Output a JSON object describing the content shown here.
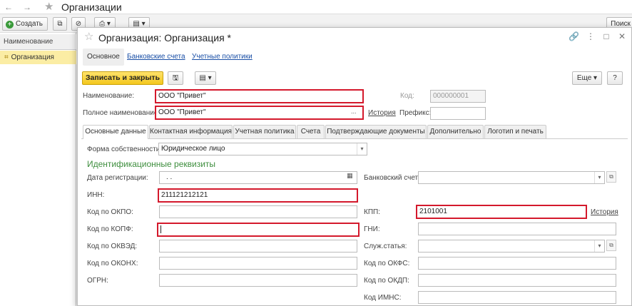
{
  "bg": {
    "title": "Организации",
    "create_label": "Создать",
    "search_label": "Поиск",
    "list_header": "Наименование",
    "list_row": "Организация"
  },
  "modal": {
    "title": "Организация: Организация *",
    "nav": {
      "main": "Основное",
      "bank": "Банковские счета",
      "policies": "Учетные политики"
    },
    "toolbar": {
      "save_close": "Записать и закрыть",
      "more": "Еще",
      "help": "?"
    },
    "fields": {
      "name_label": "Наименование:",
      "name_value": "ООО \"Привет\"",
      "code_label": "Код:",
      "code_value": "000000001",
      "full_name_label": "Полное наименование:",
      "full_name_value": "ООО \"Привет\"",
      "history_label": "История",
      "prefix_label": "Префикс:",
      "prefix_value": ""
    },
    "tabs": [
      "Основные данные",
      "Контактная информация",
      "Учетная политика",
      "Счета",
      "Подтверждающие документы",
      "Дополнительно",
      "Логотип и печать"
    ],
    "form": {
      "ownership_label": "Форма собственности:",
      "ownership_value": "Юридическое лицо",
      "section_title": "Идентификационные реквизиты",
      "reg_date_label": "Дата регистрации:",
      "reg_date_value": ". .",
      "bank_account_label": "Банковский счет:",
      "inn_label": "ИНН:",
      "inn_value": "211121212121",
      "okpo_label": "Код по ОКПО:",
      "kpp_label": "КПП:",
      "kpp_value": "2101001",
      "kpp_history": "История",
      "kopf_label": "Код по КОПФ:",
      "gni_label": "ГНИ:",
      "okved_label": "Код по ОКВЭД:",
      "serv_label": "Служ.статья:",
      "okonkh_label": "Код по ОКОНХ:",
      "okfs_label": "Код по ОКФС:",
      "ogrn_label": "ОГРН:",
      "okdp_label": "Код по ОКДП:",
      "imns_label": "Код ИМНС:"
    }
  },
  "colors": {
    "highlight": "#d4192c",
    "accent_button": "#f3c71e",
    "link": "#1a4fa6",
    "section": "#3e8e3e",
    "selected_row": "#fbeda4"
  }
}
